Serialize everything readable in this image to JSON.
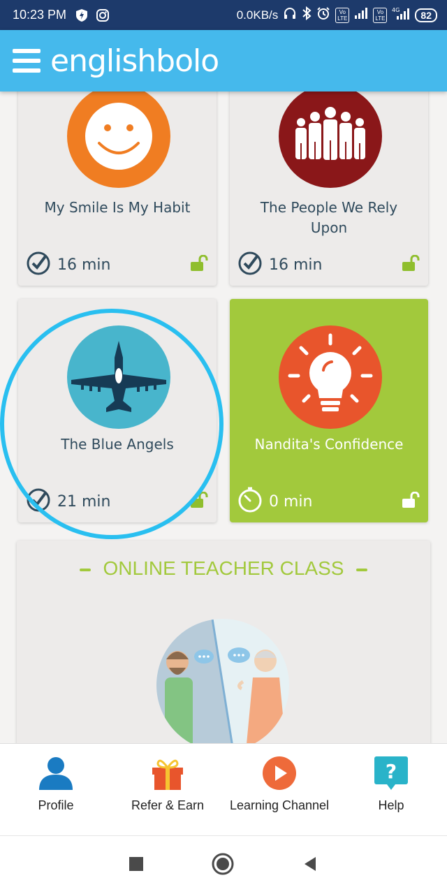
{
  "status": {
    "time": "10:23 PM",
    "speed": "0.0KB/s",
    "battery": "82",
    "lte1": "Vo\nLTE",
    "lte2": "Vo\nLTE",
    "net": "4G"
  },
  "header": {
    "app_name": "englishbolo"
  },
  "lessons": [
    {
      "title": "My Smile Is My Habit",
      "duration": "16 min",
      "icon": "smiley-icon",
      "color": "#f07d22"
    },
    {
      "title": "The People We Rely Upon",
      "duration": "16 min",
      "icon": "people-group-icon",
      "color": "#8a1719"
    },
    {
      "title": "The Blue Angels",
      "duration": "21 min",
      "icon": "fighter-jet-icon",
      "color": "#48b5cc"
    },
    {
      "title": "Nandita's Confidence",
      "duration": "0 min",
      "icon": "lightbulb-icon",
      "color": "#e8552c"
    }
  ],
  "teacher_section": {
    "title": "ONLINE TEACHER CLASS"
  },
  "bottom_nav": [
    {
      "label": "Profile",
      "icon": "profile-icon"
    },
    {
      "label": "Refer & Earn",
      "icon": "gift-icon"
    },
    {
      "label": "Learning Channel",
      "icon": "play-icon"
    },
    {
      "label": "Help",
      "icon": "help-icon"
    }
  ],
  "colors": {
    "accent": "#45b9ec",
    "green": "#a2c93c",
    "highlight": "#29bff0"
  }
}
